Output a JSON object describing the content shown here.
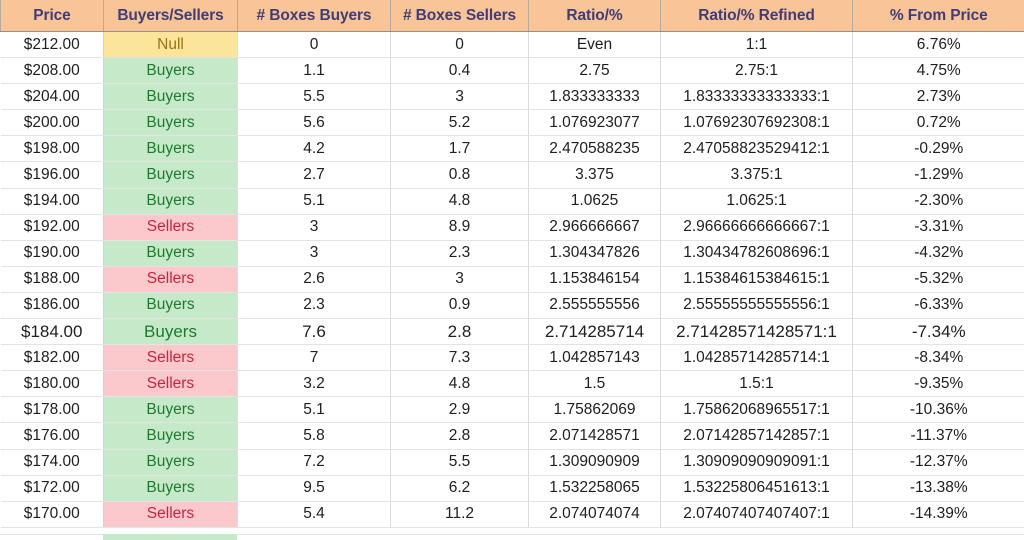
{
  "table": {
    "columns": [
      {
        "key": "price",
        "label": "Price"
      },
      {
        "key": "bs",
        "label": "Buyers/Sellers"
      },
      {
        "key": "boxes_b",
        "label": "# Boxes Buyers"
      },
      {
        "key": "boxes_s",
        "label": "# Boxes Sellers"
      },
      {
        "key": "ratio",
        "label": "Ratio/%"
      },
      {
        "key": "refined",
        "label": "Ratio/% Refined"
      },
      {
        "key": "pct",
        "label": "% From Price"
      }
    ],
    "colors": {
      "header_bg": "#F9C496",
      "header_text": "#3F3D7A",
      "buyers_bg": "#C6EAC9",
      "buyers_text": "#1E7A2E",
      "sellers_bg": "#FBC8CC",
      "sellers_text": "#C9243F",
      "null_bg": "#FBE59B",
      "null_text": "#9A7414",
      "grid": "#e3e3e3",
      "body_text": "#202020"
    },
    "rows": [
      {
        "price": "$212.00",
        "bs": "Null",
        "state": "null",
        "boxes_b": "0",
        "boxes_s": "0",
        "ratio": "Even",
        "refined": "1:1",
        "pct": "6.76%"
      },
      {
        "price": "$208.00",
        "bs": "Buyers",
        "state": "buyers",
        "boxes_b": "1.1",
        "boxes_s": "0.4",
        "ratio": "2.75",
        "refined": "2.75:1",
        "pct": "4.75%"
      },
      {
        "price": "$204.00",
        "bs": "Buyers",
        "state": "buyers",
        "boxes_b": "5.5",
        "boxes_s": "3",
        "ratio": "1.833333333",
        "refined": "1.83333333333333:1",
        "pct": "2.73%"
      },
      {
        "price": "$200.00",
        "bs": "Buyers",
        "state": "buyers",
        "boxes_b": "5.6",
        "boxes_s": "5.2",
        "ratio": "1.076923077",
        "refined": "1.07692307692308:1",
        "pct": "0.72%"
      },
      {
        "price": "$198.00",
        "bs": "Buyers",
        "state": "buyers",
        "boxes_b": "4.2",
        "boxes_s": "1.7",
        "ratio": "2.470588235",
        "refined": "2.47058823529412:1",
        "pct": "-0.29%"
      },
      {
        "price": "$196.00",
        "bs": "Buyers",
        "state": "buyers",
        "boxes_b": "2.7",
        "boxes_s": "0.8",
        "ratio": "3.375",
        "refined": "3.375:1",
        "pct": "-1.29%"
      },
      {
        "price": "$194.00",
        "bs": "Buyers",
        "state": "buyers",
        "boxes_b": "5.1",
        "boxes_s": "4.8",
        "ratio": "1.0625",
        "refined": "1.0625:1",
        "pct": "-2.30%"
      },
      {
        "price": "$192.00",
        "bs": "Sellers",
        "state": "sellers",
        "boxes_b": "3",
        "boxes_s": "8.9",
        "ratio": "2.966666667",
        "refined": "2.96666666666667:1",
        "pct": "-3.31%"
      },
      {
        "price": "$190.00",
        "bs": "Buyers",
        "state": "buyers",
        "boxes_b": "3",
        "boxes_s": "2.3",
        "ratio": "1.304347826",
        "refined": "1.30434782608696:1",
        "pct": "-4.32%"
      },
      {
        "price": "$188.00",
        "bs": "Sellers",
        "state": "sellers",
        "boxes_b": "2.6",
        "boxes_s": "3",
        "ratio": "1.153846154",
        "refined": "1.15384615384615:1",
        "pct": "-5.32%"
      },
      {
        "price": "$186.00",
        "bs": "Buyers",
        "state": "buyers",
        "boxes_b": "2.3",
        "boxes_s": "0.9",
        "ratio": "2.555555556",
        "refined": "2.55555555555556:1",
        "pct": "-6.33%"
      },
      {
        "price": "$184.00",
        "bs": "Buyers",
        "state": "buyers",
        "boxes_b": "7.6",
        "boxes_s": "2.8",
        "ratio": "2.714285714",
        "refined": "2.71428571428571:1",
        "pct": "-7.34%",
        "big": true
      },
      {
        "price": "$182.00",
        "bs": "Sellers",
        "state": "sellers",
        "boxes_b": "7",
        "boxes_s": "7.3",
        "ratio": "1.042857143",
        "refined": "1.04285714285714:1",
        "pct": "-8.34%"
      },
      {
        "price": "$180.00",
        "bs": "Sellers",
        "state": "sellers",
        "boxes_b": "3.2",
        "boxes_s": "4.8",
        "ratio": "1.5",
        "refined": "1.5:1",
        "pct": "-9.35%"
      },
      {
        "price": "$178.00",
        "bs": "Buyers",
        "state": "buyers",
        "boxes_b": "5.1",
        "boxes_s": "2.9",
        "ratio": "1.75862069",
        "refined": "1.75862068965517:1",
        "pct": "-10.36%"
      },
      {
        "price": "$176.00",
        "bs": "Buyers",
        "state": "buyers",
        "boxes_b": "5.8",
        "boxes_s": "2.8",
        "ratio": "2.071428571",
        "refined": "2.07142857142857:1",
        "pct": "-11.37%"
      },
      {
        "price": "$174.00",
        "bs": "Buyers",
        "state": "buyers",
        "boxes_b": "7.2",
        "boxes_s": "5.5",
        "ratio": "1.309090909",
        "refined": "1.30909090909091:1",
        "pct": "-12.37%"
      },
      {
        "price": "$172.00",
        "bs": "Buyers",
        "state": "buyers",
        "boxes_b": "9.5",
        "boxes_s": "6.2",
        "ratio": "1.532258065",
        "refined": "1.53225806451613:1",
        "pct": "-13.38%"
      },
      {
        "price": "$170.00",
        "bs": "Sellers",
        "state": "sellers",
        "boxes_b": "5.4",
        "boxes_s": "11.2",
        "ratio": "2.074074074",
        "refined": "2.07407407407407:1",
        "pct": "-14.39%"
      }
    ]
  }
}
